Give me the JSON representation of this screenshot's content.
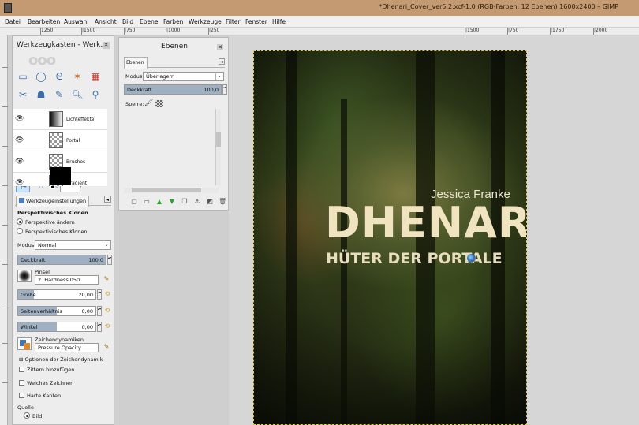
{
  "window": {
    "title": "*Dhenari_Cover_ver5.2.xcf-1.0 (RGB-Farben, 12 Ebenen) 1600x2400 – GIMP"
  },
  "menubar": {
    "items": [
      "Datei",
      "Bearbeiten",
      "Auswahl",
      "Ansicht",
      "Bild",
      "Ebene",
      "Farben",
      "Werkzeuge",
      "Filter",
      "Fenster",
      "Hilfe"
    ]
  },
  "ruler": {
    "labels": [
      "1250",
      "|1500",
      "|750",
      "|1000",
      "|250",
      "|1500",
      "|750",
      "|1750",
      "|2000"
    ]
  },
  "toolbox": {
    "title": "Werkzeugkasten - Werk...",
    "tab_label": "Werkzeugeinstellungen",
    "tool_name": "Perspektivisches Klonen",
    "mode_radio_1": "Perspektive ändern",
    "mode_radio_2": "Perspektivisches Klonen",
    "modus_label": "Modus:",
    "modus_value": "Normal",
    "opacity_label": "Deckkraft",
    "opacity_value": "100,0",
    "brush_label": "Pinsel",
    "brush_value": "2. Hardness 050",
    "size_label": "Größe",
    "size_value": "20,00",
    "aspect_label": "Seitenverhältnis",
    "aspect_value": "0,00",
    "angle_label": "Winkel",
    "angle_value": "0,00",
    "dynamics_label": "Zeichendynamiken",
    "dynamics_value": "Pressure Opacity",
    "dynamics_options": "Optionen der Zeichendynamik",
    "jitter": "Zittern hinzufügen",
    "smooth": "Weiches Zeichnen",
    "hard_edges": "Harte Kanten",
    "source_label": "Quelle",
    "source_image": "Bild"
  },
  "layers": {
    "title": "Ebenen",
    "tab_label": "Ebenen",
    "mode_label": "Modus:",
    "mode_value": "Überlagern",
    "opacity_label": "Deckkraft",
    "opacity_value": "100,0",
    "lock_label": "Sperre:",
    "items": [
      {
        "name": "Lichteffekte"
      },
      {
        "name": "Portal"
      },
      {
        "name": "Brushes"
      },
      {
        "name": "Gradient"
      }
    ]
  },
  "cover": {
    "author": "Jessica Franke",
    "title": "DHENARI",
    "subtitle": "HÜTER DER PORTALE"
  }
}
